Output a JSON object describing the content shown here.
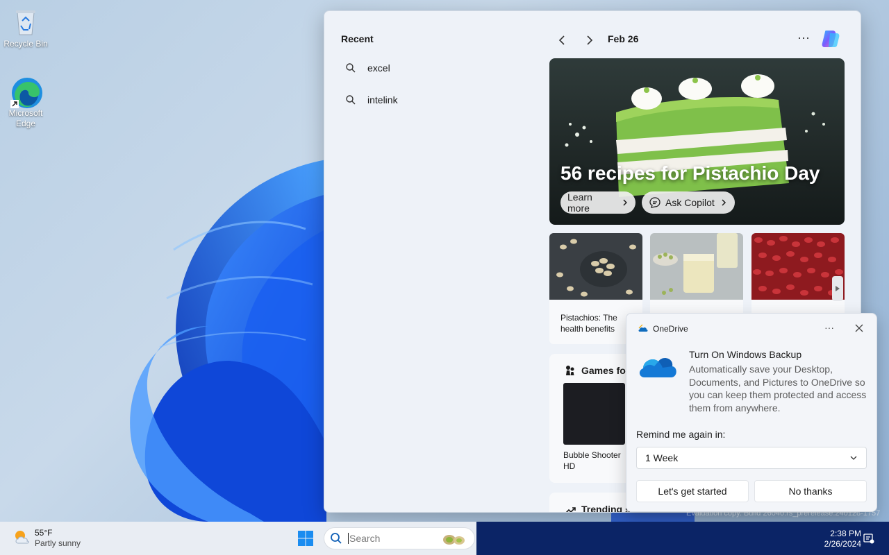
{
  "desktop": {
    "icons": [
      {
        "label": "Recycle Bin",
        "icon": "recycle-bin-icon"
      },
      {
        "label": "Microsoft Edge",
        "icon": "edge-icon"
      }
    ]
  },
  "search_panel": {
    "recent_title": "Recent",
    "recent_items": [
      {
        "label": "excel",
        "icon": "search-icon"
      },
      {
        "label": "intelink",
        "icon": "search-icon"
      }
    ],
    "date": "Feb 26",
    "hero": {
      "title": "56 recipes for Pistachio Day",
      "learn_more": "Learn more",
      "ask_copilot": "Ask Copilot"
    },
    "cards": [
      {
        "caption": "Pistachios: The health benefits"
      },
      {
        "caption": ""
      },
      {
        "caption": ""
      }
    ],
    "games_title": "Games for",
    "game_name": "Bubble Shooter HD",
    "trending_title": "Trending s"
  },
  "onedrive_toast": {
    "app_name": "OneDrive",
    "heading": "Turn On Windows Backup",
    "body": "Automatically save your Desktop, Documents, and Pictures to OneDrive so you can keep them protected and access them from anywhere.",
    "remind_label": "Remind me again in:",
    "remind_value": "1 Week",
    "primary_button": "Let's get started",
    "secondary_button": "No thanks"
  },
  "watermark": "Evaluation copy. Build 26040.rs_prerelease.240128-1757",
  "taskbar": {
    "weather_temp": "55°F",
    "weather_cond": "Partly sunny",
    "search_placeholder": "Search",
    "time": "2:38 PM",
    "date": "2/26/2024"
  },
  "colors": {
    "accent": "#0067c0",
    "taskbar_dark": "#0b2466",
    "onedrive_blue": "#0f6cbd"
  }
}
